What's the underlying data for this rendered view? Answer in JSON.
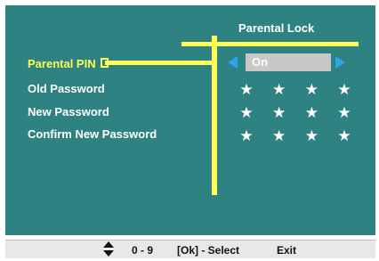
{
  "title": "Parental Lock",
  "rows": [
    {
      "label": "Parental PIN",
      "value": "On"
    },
    {
      "label": "Old Password",
      "mask": [
        "★",
        "★",
        "★",
        "★"
      ]
    },
    {
      "label": "New Password",
      "mask": [
        "★",
        "★",
        "★",
        "★"
      ]
    },
    {
      "label": "Confirm New Password",
      "mask": [
        "★",
        "★",
        "★",
        "★"
      ]
    }
  ],
  "footer": {
    "nav_icon": "up-down-arrows-icon",
    "digits": "0 - 9",
    "ok_select": "[Ok] - Select",
    "exit": "Exit"
  },
  "colors": {
    "background": "#2e8282",
    "highlight": "#ffff55",
    "arrow": "#2ea4ea",
    "value_box": "#c8c8c8"
  }
}
